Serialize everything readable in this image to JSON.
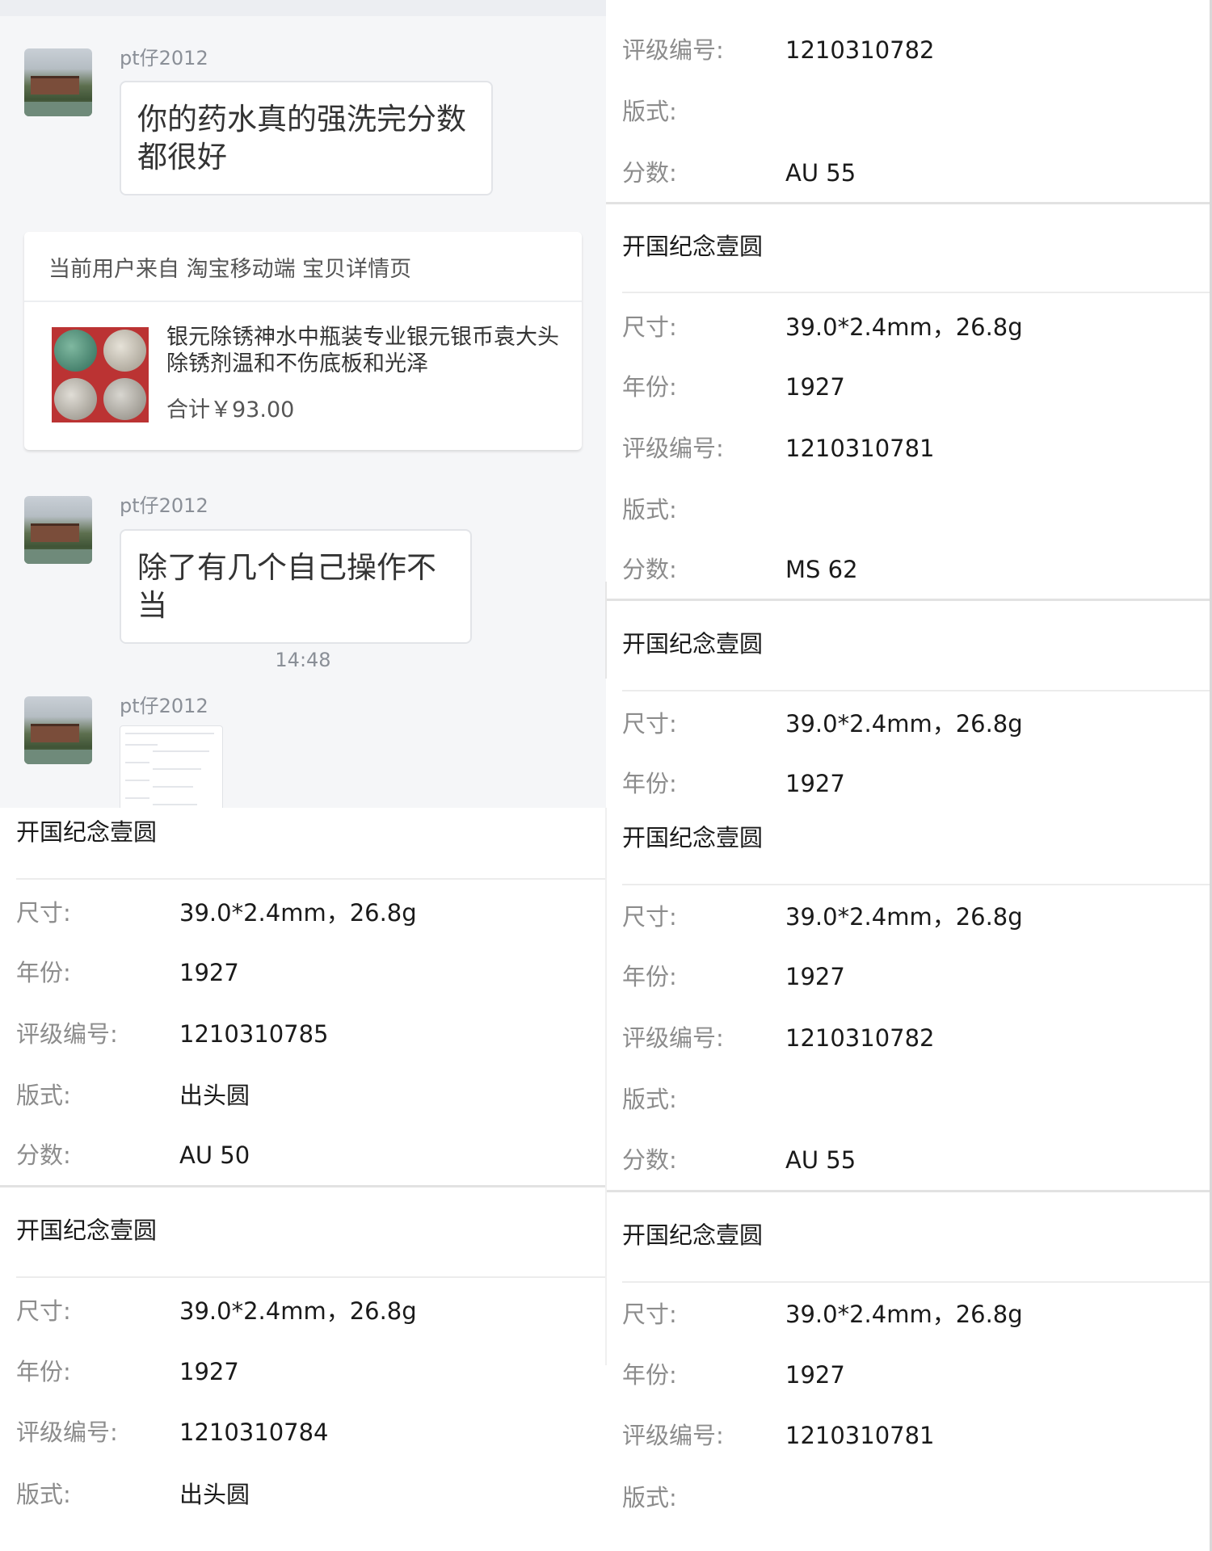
{
  "chat": {
    "messages": [
      {
        "sender": "pt仔2012",
        "text": "你的药水真的强洗完分数都很好"
      },
      {
        "sender": "pt仔2012",
        "text": "除了有几个自己操作不当"
      },
      {
        "sender": "pt仔2012",
        "text": ""
      }
    ],
    "source_card": {
      "source_text": "当前用户来自 淘宝移动端 宝贝详情页",
      "product_title": "银元除锈神水中瓶装专业银元银币袁大头除锈剂温和不伤底板和光泽",
      "price": "合计￥93.00"
    },
    "timestamp": "14:48"
  },
  "labels": {
    "size": "尺寸:",
    "year": "年份:",
    "grade_no": "评级编号:",
    "variety": "版式:",
    "score": "分数:"
  },
  "top_right": {
    "partial": {
      "grade_no": "1210310782",
      "variety": "",
      "score": "AU 55"
    },
    "cards": [
      {
        "title": "开国纪念壹圆",
        "size": "39.0*2.4mm，26.8g",
        "year": "1927",
        "grade_no": "1210310781",
        "variety": "",
        "score": "MS 62"
      },
      {
        "title": "开国纪念壹圆",
        "size": "39.0*2.4mm，26.8g",
        "year": "1927"
      }
    ]
  },
  "bottom_left": {
    "cards": [
      {
        "title": "开国纪念壹圆",
        "size": "39.0*2.4mm，26.8g",
        "year": "1927",
        "grade_no": "1210310785",
        "variety": "出头圆",
        "score": "AU 50"
      },
      {
        "title": "开国纪念壹圆",
        "size": "39.0*2.4mm，26.8g",
        "year": "1927",
        "grade_no": "1210310784",
        "variety": "出头圆"
      }
    ]
  },
  "bottom_right": {
    "cards": [
      {
        "title": "开国纪念壹圆",
        "size": "39.0*2.4mm，26.8g",
        "year": "1927",
        "grade_no": "1210310782",
        "variety": "",
        "score": "AU 55"
      },
      {
        "title": "开国纪念壹圆",
        "size": "39.0*2.4mm，26.8g",
        "year": "1927",
        "grade_no": "1210310781",
        "variety": ""
      }
    ]
  }
}
